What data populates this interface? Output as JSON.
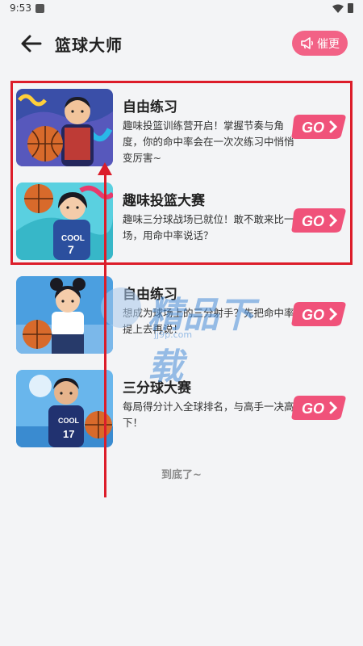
{
  "status_bar": {
    "time": "9:53"
  },
  "header": {
    "back_icon": "arrow-left-icon",
    "title": "篮球大师",
    "urge_button": {
      "icon": "megaphone-icon",
      "label": "催更"
    }
  },
  "games": [
    {
      "title": "自由练习",
      "description": "趣味投篮训练营开启！掌握节奏与角度，你的命中率会在一次次练习中悄悄变厉害~",
      "button": "GO",
      "thumb_jersey": ""
    },
    {
      "title": "趣味投篮大赛",
      "description": "趣味三分球战场已就位！敢不敢来比一场，用命中率说话？",
      "button": "GO",
      "thumb_jersey": "COOL 7"
    },
    {
      "title": "自由练习",
      "description": "想成为球场上的三分射手？先把命中率提上去再说！",
      "button": "GO",
      "thumb_jersey": ""
    },
    {
      "title": "三分球大赛",
      "description": "每局得分计入全球排名，与高手一决高下！",
      "button": "GO",
      "thumb_jersey": ""
    }
  ],
  "footer": {
    "end_text": "到底了~"
  },
  "watermark": {
    "text": "精品下载",
    "site": "jj9p.com"
  },
  "colors": {
    "accent": "#f26286",
    "annotation": "#dc1d2a",
    "background": "#f3f4f6"
  }
}
